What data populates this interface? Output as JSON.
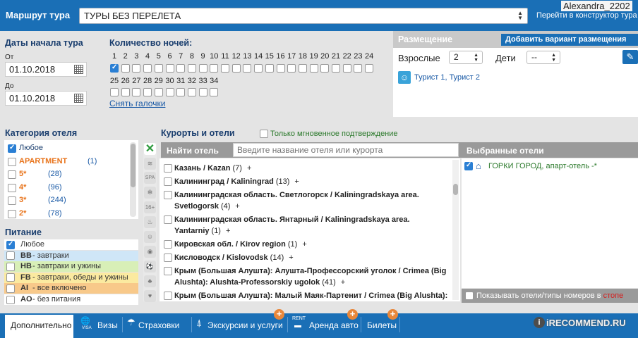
{
  "topbar": {
    "route_label": "Маршрут тура",
    "route_value": "ТУРЫ БЕЗ ПЕРЕЛЕТА",
    "username": "Alexandra_2202",
    "constructor_link": "Перейти в конструктор тура"
  },
  "dates": {
    "title": "Даты начала тура",
    "from_label": "От",
    "from_value": "01.10.2018",
    "to_label": "До",
    "to_value": "01.10.2018"
  },
  "nights": {
    "title": "Количество ночей:",
    "row1": [
      "1",
      "2",
      "3",
      "4",
      "5",
      "6",
      "7",
      "8",
      "9",
      "10",
      "11",
      "12",
      "13",
      "14",
      "15",
      "16",
      "17",
      "18",
      "19",
      "20",
      "21",
      "22",
      "23",
      "24"
    ],
    "row2": [
      "25",
      "26",
      "27",
      "28",
      "29",
      "30",
      "31",
      "32",
      "33",
      "34"
    ],
    "checked": [
      "1"
    ],
    "clear_link": "Снять галочки"
  },
  "placement": {
    "title": "Размещение",
    "add_button": "Добавить вариант размещения",
    "adults_label": "Взрослые",
    "adults_value": "2",
    "children_label": "Дети",
    "children_value": "--",
    "tourists": "Турист 1, Турист 2"
  },
  "category": {
    "title": "Категория отеля",
    "items": [
      {
        "label": "Любое",
        "count": "",
        "checked": true
      },
      {
        "label": "APARTMENT",
        "count": "(1)",
        "checked": false
      },
      {
        "label": "5*",
        "count": "(28)",
        "checked": false
      },
      {
        "label": "4*",
        "count": "(96)",
        "checked": false
      },
      {
        "label": "3*",
        "count": "(244)",
        "checked": false
      },
      {
        "label": "2*",
        "count": "(78)",
        "checked": false
      }
    ]
  },
  "meals": {
    "title": "Питание",
    "items": [
      {
        "code": "",
        "label": "Любое",
        "checked": true,
        "color": "#ffffff"
      },
      {
        "code": "BB",
        "label": "- завтраки",
        "checked": false,
        "color": "#cfe6f7"
      },
      {
        "code": "HB",
        "label": "- завтраки и ужины",
        "checked": false,
        "color": "#d8efb7"
      },
      {
        "code": "FB",
        "label": "- завтраки, обеды и ужины",
        "checked": false,
        "color": "#fbeaa0"
      },
      {
        "code": "AI",
        "label": "- все включено",
        "checked": false,
        "color": "#f8c98a"
      },
      {
        "code": "AO",
        "label": "- без питания",
        "checked": false,
        "color": "#ffffff"
      }
    ]
  },
  "resorts": {
    "title": "Курорты и отели",
    "instant_confirm": "Только мгновенное подтверждение",
    "find_hotel": "Найти отель",
    "search_placeholder": "Введите название отеля или курорта",
    "rows": [
      {
        "name": "Казань / Kazan",
        "count": "(7)"
      },
      {
        "name": "Калининград / Kaliningrad",
        "count": "(13)"
      },
      {
        "name": "Калининградская область. Светлогорск / Kaliningradskaya area.",
        "name2": "Svetlogorsk",
        "count": "(4)"
      },
      {
        "name": "Калининградская область. Янтарный / Kaliningradskaya area.",
        "name2": "Yantarniy",
        "count": "(1)"
      },
      {
        "name": "Кировская обл. / Kirov region",
        "count": "(1)"
      },
      {
        "name": "Кисловодск / Kislovodsk",
        "count": "(14)"
      },
      {
        "name": "Крым (Большая Алушта): Алушта-Профессорский уголок / Crimea (Big",
        "name2": "Alushta): Alushta-Professorskiy ugolok",
        "count": "(41)"
      },
      {
        "name": "Крым (Большая Алушта): Малый Маяк-Партенит / Crimea (Big Alushta):",
        "count": ""
      }
    ],
    "plus": "+"
  },
  "selected": {
    "title": "Выбранные отели",
    "hotel": "ГОРКИ ГОРОД, апарт-отель -*",
    "show_label": "Показывать отели/типы номеров в",
    "show_label_red": "стопе"
  },
  "tabs": [
    {
      "label": "Дополнительно"
    },
    {
      "label": "Визы"
    },
    {
      "label": "Страховки"
    },
    {
      "label": "Экскурсии и услуги"
    },
    {
      "label": "Аренда авто"
    },
    {
      "label": "Билеты"
    }
  ],
  "watermark": "iRECOMMEND.RU",
  "colors": {
    "header_blue": "#1a6fb6",
    "accent_orange": "#e8873a",
    "green_text": "#2c7a2c"
  }
}
